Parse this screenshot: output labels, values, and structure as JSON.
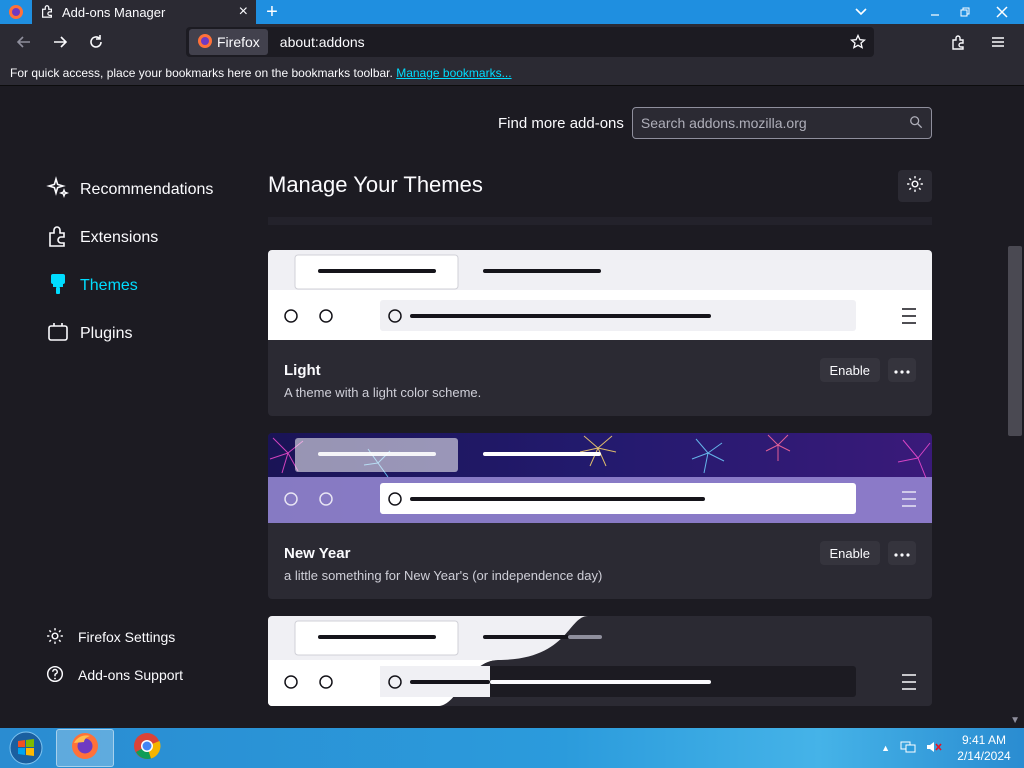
{
  "browser": {
    "tab_title": "Add-ons Manager",
    "identity_label": "Firefox",
    "url": "about:addons",
    "bookmarks_hint": "For quick access, place your bookmarks here on the bookmarks toolbar.",
    "bookmarks_link": "Manage bookmarks..."
  },
  "addons": {
    "find_more_label": "Find more add-ons",
    "search_placeholder": "Search addons.mozilla.org",
    "categories": [
      {
        "label": "Recommendations",
        "icon": "sparkle-icon",
        "active": false
      },
      {
        "label": "Extensions",
        "icon": "puzzle-icon",
        "active": false
      },
      {
        "label": "Themes",
        "icon": "paintbrush-icon",
        "active": true
      },
      {
        "label": "Plugins",
        "icon": "plugin-icon",
        "active": false
      }
    ],
    "footer": {
      "settings": "Firefox Settings",
      "support": "Add-ons Support"
    },
    "heading": "Manage Your Themes",
    "themes": [
      {
        "name": "Light",
        "description": "A theme with a light color scheme.",
        "action": "Enable"
      },
      {
        "name": "New Year",
        "description": "a little something for New Year's (or independence day)",
        "action": "Enable"
      }
    ]
  },
  "taskbar": {
    "time": "9:41 AM",
    "date": "2/14/2024"
  },
  "colors": {
    "accent": "#00ddff",
    "background": "#1c1b22",
    "card": "#2b2a33",
    "taskbar": "#2b9bdc"
  }
}
